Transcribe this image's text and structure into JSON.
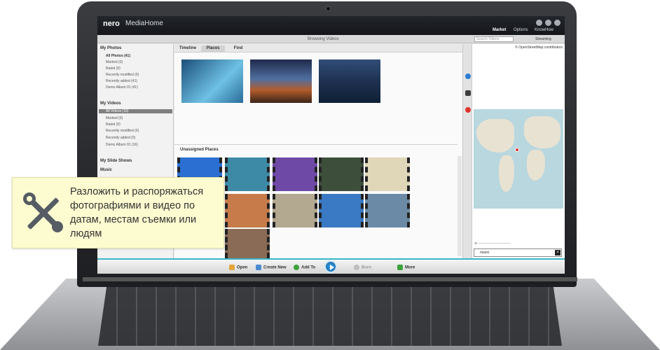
{
  "app": {
    "brand": "nero",
    "name": "MediaHome",
    "toolbar_title": "Browsing Videos",
    "search_placeholder": "Search Videos",
    "streaming": "Streaming"
  },
  "menu": {
    "market": "Market",
    "options": "Options",
    "knowhow": "KnowHow"
  },
  "sidebar": {
    "photos": {
      "title": "My Photos",
      "items": [
        "All Photos (41)",
        "Marked (0)",
        "Rated (0)",
        "Recently modified (0)",
        "Recently added (41)",
        "Demo Album 01 (41)"
      ]
    },
    "videos": {
      "title": "My Videos",
      "items": [
        "All Videos (16)",
        "Marked (0)",
        "Rated (0)",
        "Recently modified (0)",
        "Recently added (0)",
        "Demo Album 01 (16)"
      ]
    },
    "slideshows": "My Slide Shows",
    "music": "Music"
  },
  "tabs": [
    "Timeline",
    "Places",
    "Find"
  ],
  "main": {
    "unassigned": "Unassigned Places"
  },
  "map": {
    "attribution": "© OpenStreetMap contributors",
    "search_value": "miami"
  },
  "bottombar": {
    "open": "Open",
    "create_new": "Create New",
    "add_to": "Add To",
    "burn": "Burn",
    "more": "More"
  },
  "callout": {
    "text": "Разложить и распоряжаться фотографиями и видео по датам, местам съемки или людям"
  },
  "colors": {
    "accent": "#3ab6c8",
    "callout_bg": "#fdfbd0",
    "selection": "#7f7f7f"
  },
  "icons": [
    "tools-icon",
    "play-icon",
    "info-icon",
    "location-pin-icon",
    "folder-icon",
    "plus-icon",
    "up-arrow-icon"
  ]
}
